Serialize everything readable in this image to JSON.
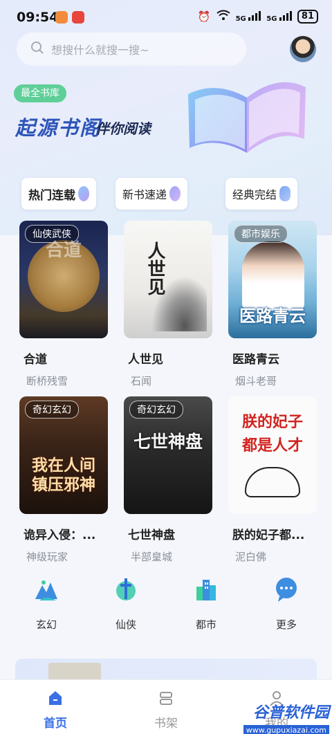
{
  "status": {
    "time": "09:54",
    "net1": "5G",
    "net2": "5G",
    "battery": "81"
  },
  "search": {
    "placeholder": "想搜什么就搜一搜~"
  },
  "banner": {
    "badge": "最全书库",
    "title": "起源书阁",
    "subtitle": "伴你阅读"
  },
  "tabs": [
    {
      "label": "热门连载",
      "active": true
    },
    {
      "label": "新书速递",
      "active": false
    },
    {
      "label": "经典完结",
      "active": false
    }
  ],
  "books": [
    {
      "title": "合道",
      "author": "断桥残雪",
      "tag": "仙侠武侠",
      "cover_text": "合道",
      "cover_colors": [
        "#1e2a52",
        "#b58a46"
      ]
    },
    {
      "title": "人世见",
      "author": "石闻",
      "tag": "",
      "cover_text": "人世见",
      "cover_colors": [
        "#f3f3f0",
        "#3a3a3a"
      ]
    },
    {
      "title": "医路青云",
      "author": "烟斗老哥",
      "tag": "都市娱乐",
      "cover_text": "医路青云",
      "cover_colors": [
        "#9fd4ee",
        "#2d6a9c"
      ]
    },
    {
      "title": "诡异入侵：...",
      "author": "神级玩家",
      "tag": "奇幻玄幻",
      "cover_text": "我在人间镇压邪神",
      "cover_colors": [
        "#3a2418",
        "#c4471c"
      ]
    },
    {
      "title": "七世神盘",
      "author": "半部皇城",
      "tag": "奇幻玄幻",
      "cover_text": "七世神盘",
      "cover_colors": [
        "#2c2c2c",
        "#9a9a9a"
      ]
    },
    {
      "title": "朕的妃子都...",
      "author": "泥白佛",
      "tag": "",
      "cover_text": "朕的妃子 都是人才",
      "cover_colors": [
        "#fbfbfb",
        "#d2231e"
      ]
    }
  ],
  "genres": [
    {
      "label": "玄幻",
      "icon": "mountain-icon"
    },
    {
      "label": "仙侠",
      "icon": "sword-icon"
    },
    {
      "label": "都市",
      "icon": "buildings-icon"
    },
    {
      "label": "更多",
      "icon": "more-icon"
    }
  ],
  "nav": [
    {
      "label": "首页",
      "icon": "home-icon",
      "active": true
    },
    {
      "label": "书架",
      "icon": "bookshelf-icon",
      "active": false
    },
    {
      "label": "我的",
      "icon": "profile-icon",
      "active": false
    }
  ],
  "watermark": {
    "main": "谷普软件园",
    "url": "www.gupuxiazai.com"
  },
  "colors": {
    "accent": "#3a6fe6",
    "badge": "#5fcf98",
    "title": "#2d55b8"
  }
}
